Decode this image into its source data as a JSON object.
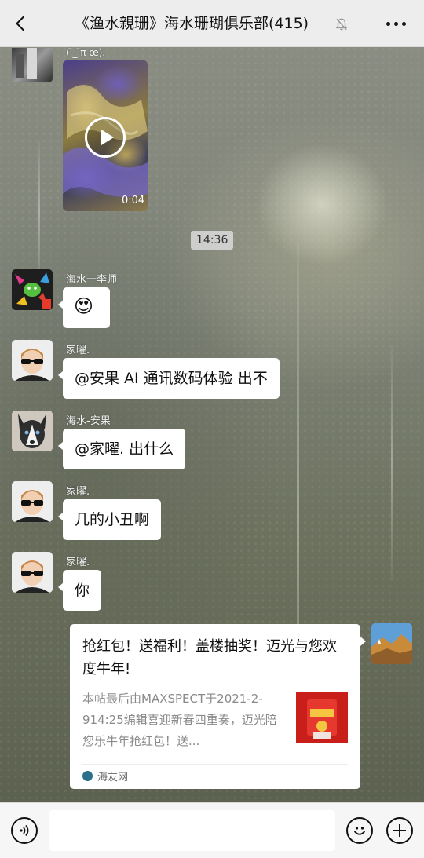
{
  "header": {
    "title": "《渔水親珊》海水珊瑚俱乐部(415)"
  },
  "messages": [
    {
      "sender": "海水一李师",
      "text": "😍"
    },
    {
      "sender": "家曜.",
      "text": "@安果 AI 通讯数码体验  出不"
    },
    {
      "sender": "海水-安果",
      "text": "@家曜.  出什么"
    },
    {
      "sender": "家曜.",
      "text": "几的小丑啊"
    },
    {
      "sender": "家曜.",
      "text": "你"
    }
  ],
  "video": {
    "duration": "0:04",
    "partial_sender": "( ̄_ ̄π œ)."
  },
  "timestamp": "14:36",
  "card": {
    "title": "抢红包！送福利！盖楼抽奖！迈光与您欢度牛年!",
    "description": "本帖最后由MAXSPECT于2021-2-914:25编辑喜迎新春四重奏，迈光陪您乐牛年抢红包！送...",
    "source": "海友网"
  },
  "icons": {
    "back": "chevron-left-icon",
    "mute": "bell-muted-icon",
    "more": "more-dots-icon",
    "voice": "voice-icon",
    "emoji": "emoji-icon",
    "plus": "plus-icon"
  }
}
